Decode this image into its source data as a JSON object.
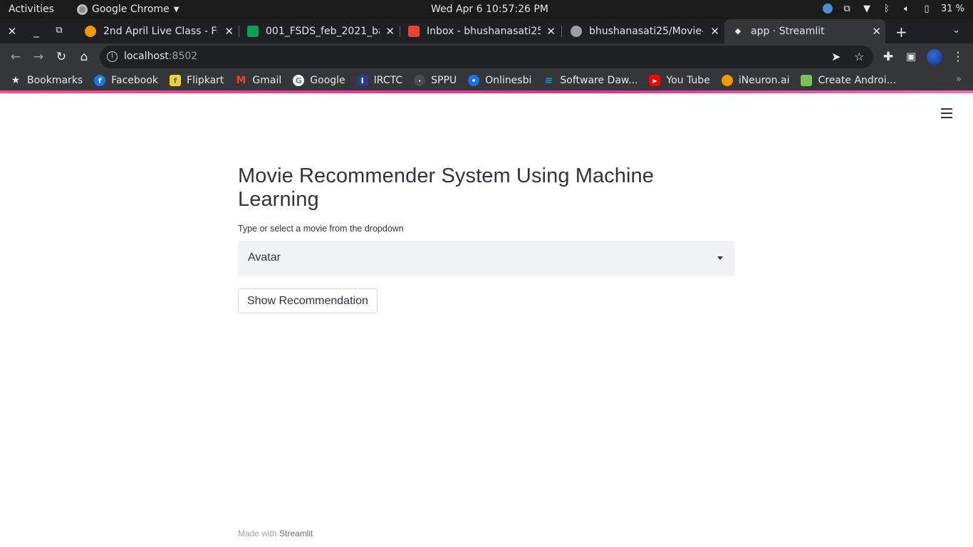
{
  "system_bar": {
    "activities": "Activities",
    "app_name": "Google Chrome",
    "clock": "Wed Apr 6  10:57:26 PM",
    "battery": "31 %"
  },
  "tabs": [
    {
      "title": "2nd April Live Class - Ful",
      "favicon_color": "#f29900"
    },
    {
      "title": "001_FSDS_feb_2021_bat",
      "favicon_color": "#0f9d58"
    },
    {
      "title": "Inbox - bhushanasati25",
      "favicon_color": "#ea4335"
    },
    {
      "title": "bhushanasati25/Movie-",
      "favicon_color": "#9aa0a6"
    },
    {
      "title": "app · Streamlit",
      "favicon_color": "#e8e8e8"
    }
  ],
  "omnibox": {
    "host": "localhost",
    "port": ":8502"
  },
  "bookmarks": [
    {
      "label": "Bookmarks",
      "icon": "star-icon",
      "color": "#e8e8e8"
    },
    {
      "label": "Facebook",
      "icon": "facebook-icon",
      "color": "#1877f2"
    },
    {
      "label": "Flipkart",
      "icon": "flipkart-icon",
      "color": "#f9d12a"
    },
    {
      "label": "Gmail",
      "icon": "gmail-icon",
      "color": "#ea4335"
    },
    {
      "label": "Google",
      "icon": "google-icon",
      "color": "#ffffff"
    },
    {
      "label": "IRCTC",
      "icon": "irctc-icon",
      "color": "#2b3a8c"
    },
    {
      "label": "SPPU",
      "icon": "sppu-icon",
      "color": "#5f6368"
    },
    {
      "label": "Onlinesbi",
      "icon": "sbi-icon",
      "color": "#1a73e8"
    },
    {
      "label": "Software Daw...",
      "icon": "software-icon",
      "color": "#1aa0d8"
    },
    {
      "label": "You Tube",
      "icon": "youtube-icon",
      "color": "#ff0000"
    },
    {
      "label": "iNeuron.ai",
      "icon": "ineuron-icon",
      "color": "#f29900"
    },
    {
      "label": "Create Androi...",
      "icon": "android-icon",
      "color": "#78c257"
    }
  ],
  "app": {
    "title": "Movie Recommender System Using Machine Learning",
    "select_label": "Type or select a movie from the dropdown",
    "selected_movie": "Avatar",
    "button_label": "Show Recommendation",
    "footer_prefix": "Made with",
    "footer_brand": "Streamlit"
  }
}
